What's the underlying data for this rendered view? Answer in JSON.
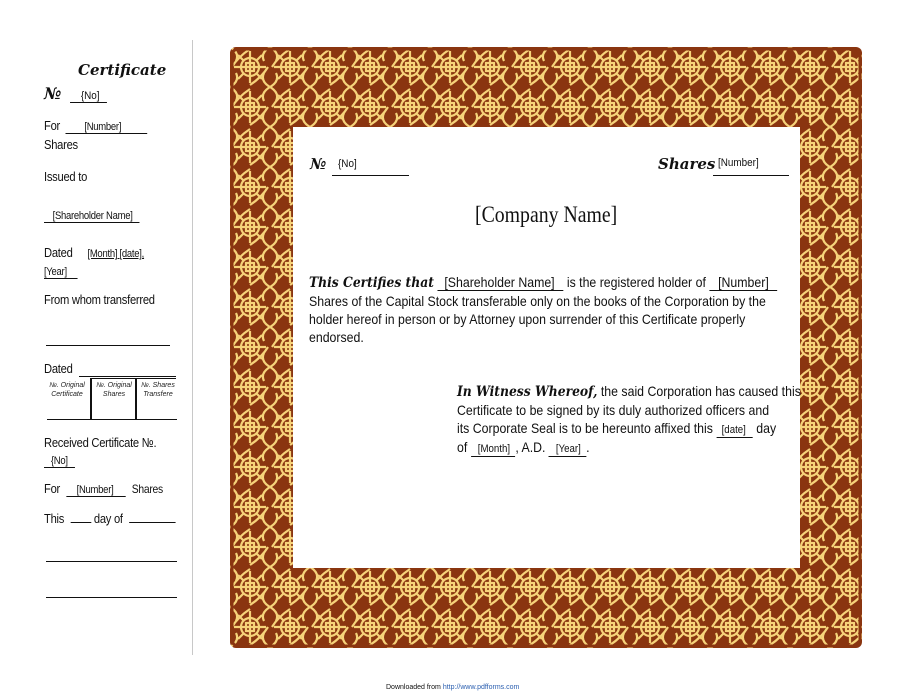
{
  "stub": {
    "title": "Certificate",
    "no_symbol": "№",
    "no_value": "{No]",
    "for_label": "For",
    "for_value": "[Number]",
    "shares_label": "Shares",
    "issued_to_label": "Issued to",
    "shareholder_value": "[Shareholder Name]",
    "dated_label": "Dated",
    "dated_value": "[Month] [date],",
    "dated_year": "[Year]",
    "from_whom_label": "From whom transferred",
    "dated2_label": "Dated",
    "table_headers": [
      "№. Original Certificate",
      "№. Original Shares",
      "№. Shares Transfere"
    ],
    "received_label": "Received Certificate №.",
    "received_value": "{No]",
    "for2_label": "For",
    "for2_value": "[Number]",
    "for2_suffix": "Shares",
    "this_label": "This",
    "day_of_label": "day of"
  },
  "certificate": {
    "no_symbol": "№",
    "no_value": "{No]",
    "shares_label": "Shares",
    "shares_value": "[Number]",
    "company_name": "[Company Name]",
    "certifies_lead": "This Certifies that",
    "shareholder_value": "[Shareholder Name]",
    "registered_text": "is the registered holder of",
    "number_value": "[Number]",
    "body_line2": "Shares of the Capital Stock transferable only on the books of the Corporation by the",
    "body_line3": "holder hereof in person or by Attorney upon surrender of this Certificate properly",
    "body_line4": "endorsed.",
    "witness_lead": "In Witness Whereof,",
    "witness_line1": "the said Corporation has caused this",
    "witness_line2": "Certificate to be signed by its duly authorized officers and",
    "witness_line3": "its Corporate Seal is to be hereunto affixed this",
    "date_value": "[date]",
    "day_label": "day",
    "of_label": "of",
    "month_value": "[Month]",
    "ad_label": ", A.D.",
    "year_value": "[Year]",
    "period": "."
  },
  "colors": {
    "border_brown": "#8a3510",
    "border_cream": "#f6d37a"
  },
  "footer": {
    "prefix": "Downloaded from",
    "link": "http://www.pdfforms.com"
  }
}
